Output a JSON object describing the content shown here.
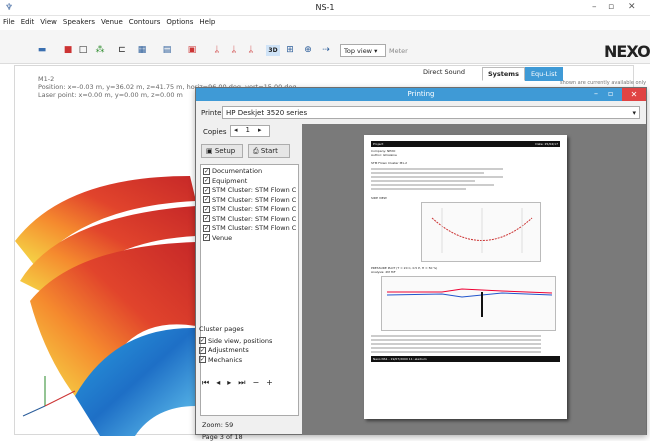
{
  "titlebar": {
    "app_icon": "♆",
    "title": "NS-1",
    "min": "–",
    "max": "▫",
    "close": "✕"
  },
  "menu": [
    "File",
    "Edit",
    "View",
    "Speakers",
    "Venue",
    "Contours",
    "Options",
    "Help"
  ],
  "toolbar": {
    "view_select": "Top view",
    "meter": "Meter",
    "logo": "NEXO",
    "icons": [
      "folder-icon",
      "save-icon",
      "new-icon",
      "network-icon",
      "speaker-icon",
      "table-icon",
      "grid-icon",
      "doc-icon",
      "probe-icon",
      "probe2-icon",
      "probe3-icon",
      "3d-icon",
      "array-icon",
      "cluster-icon",
      "arrow-icon"
    ],
    "btn_3d": "3D"
  },
  "viewport": {
    "m1": "M1-2",
    "position": "Position: x=-0.03 m, y=36.02 m, z=41.75 m, horiz=96.00 deg, vert=15.00 deg",
    "laser": "Laser point: x=0.00 m, y=0.00 m, z=0.00 m",
    "direct_sound": "Direct Sound",
    "tab_systems": "Systems",
    "tab_equ": "Equ-List",
    "note": "shown are currently available only"
  },
  "dialog": {
    "title": "Printing",
    "printers_label": "Printers",
    "printer": "HP Deskjet 3520 series",
    "copies_label": "Copies",
    "copies": "1",
    "setup": "Setup",
    "start": "Start",
    "items": [
      "Documentation",
      "Equipment",
      "STM Cluster: STM Flown Cluster",
      "STM Cluster: STM Flown Cluster",
      "STM Cluster: STM Flown Cluster",
      "STM Cluster: STM Flown Cluster",
      "STM Cluster: STM Flown Cluster",
      "Venue"
    ],
    "cluster_pages": "Cluster pages",
    "cluster_items": [
      "Side view, positions",
      "Adjustments",
      "Mechanics"
    ],
    "zoom": "Zoom: 59",
    "page": "Page 3 of 18",
    "preview": {
      "project": "Project",
      "date": "Date: 25/04/17",
      "company": "Company: NEXO",
      "author": "Author: Ghislaine",
      "cluster": "STM Flown Cluster  M1-2",
      "side_view": "SIDE VIEW",
      "pressure": "PRESSURE PLOT  (T = 20 C, 0.5 P, H = 50 %)",
      "analysis": "Analysis: 2M HiF",
      "footer": "Nexo NS1 - 19/07/2000 11: eladium"
    }
  }
}
